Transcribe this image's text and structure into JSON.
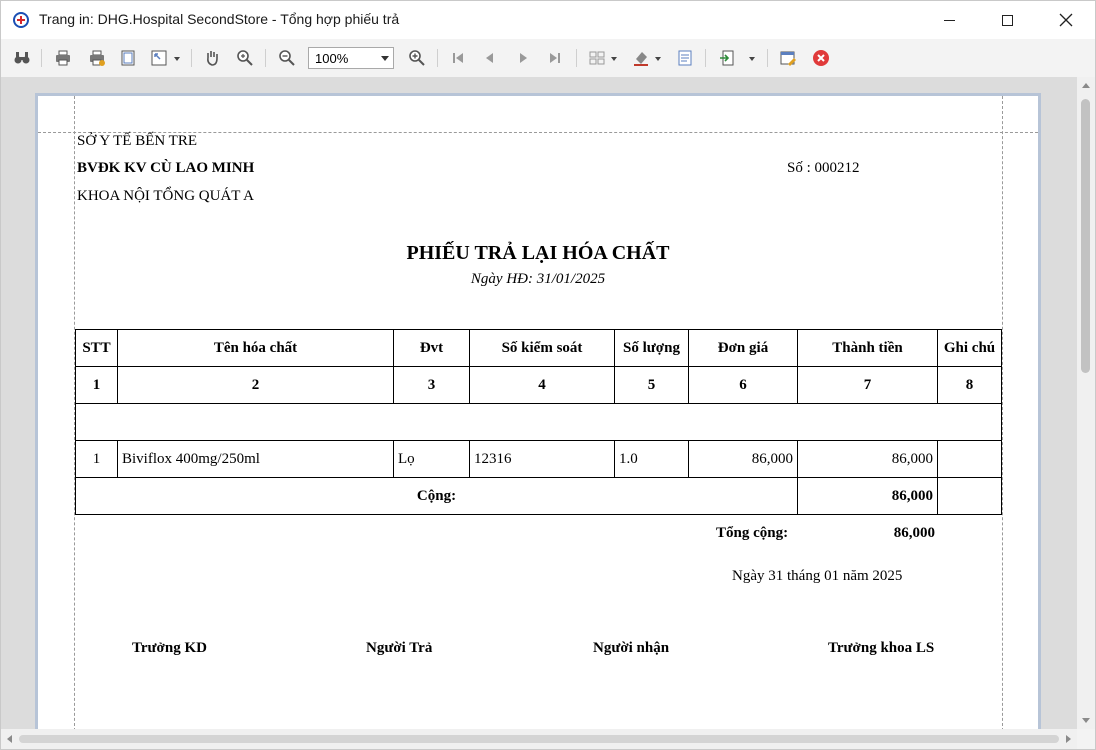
{
  "window": {
    "title": "Trang in: DHG.Hospital SecondStore - Tổng hợp phiếu trả"
  },
  "toolbar": {
    "zoom_value": "100%",
    "icons": [
      "find-icon",
      "print-icon",
      "quick-print-icon",
      "page-setup-icon",
      "scale-icon",
      "hand-tool-icon",
      "magnifier-icon",
      "zoom-out-icon",
      "zoom-in-icon",
      "first-page-icon",
      "previous-page-icon",
      "next-page-icon",
      "last-page-icon",
      "multiple-pages-icon",
      "background-color-icon",
      "watermark-icon",
      "export-icon",
      "send-icon",
      "edit-settings-icon",
      "close-preview-icon"
    ]
  },
  "document": {
    "org_department": "SỞ Y TẾ BẾN TRE",
    "hospital": "BVĐK KV CÙ LAO MINH",
    "department": "KHOA NỘI TỔNG QUÁT A",
    "number": "Số : 000212",
    "title": "PHIẾU TRẢ LẠI HÓA CHẤT",
    "date_line": "Ngày HĐ: 31/01/2025",
    "table": {
      "headers": [
        "STT",
        "Tên hóa chất",
        "Đvt",
        "Số kiểm soát",
        "Số lượng",
        "Đơn giá",
        "Thành tiền",
        "Ghi chú"
      ],
      "index_row": [
        "1",
        "2",
        "3",
        "4",
        "5",
        "6",
        "7",
        "8"
      ],
      "rows": [
        [
          "1",
          "Biviflox 400mg/250ml",
          "Lọ",
          "12316",
          "1.0",
          "86,000",
          "86,000",
          ""
        ]
      ],
      "subtotal_label": "Cộng:",
      "subtotal_value": "86,000"
    },
    "total_label": "Tổng cộng:",
    "total_value": "86,000",
    "sign_date": "Ngày 31 tháng 01 năm 2025",
    "signatures": [
      "Trưởng KD",
      "Người Trả",
      "Người nhận",
      "Trưởng khoa LS"
    ]
  }
}
